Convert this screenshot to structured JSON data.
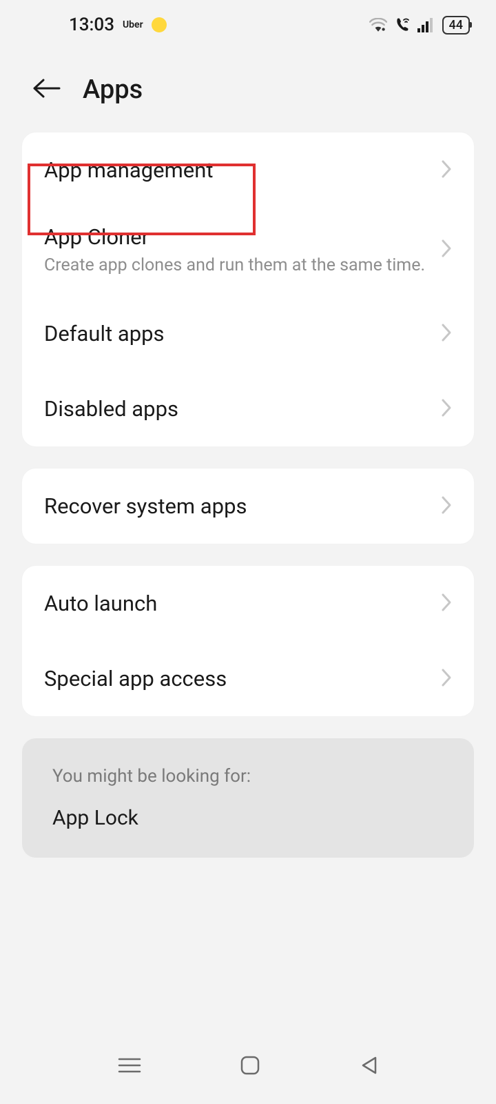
{
  "status": {
    "time": "13:03",
    "app_label": "Uber",
    "battery": "44"
  },
  "header": {
    "title": "Apps"
  },
  "groups": [
    {
      "items": [
        {
          "title": "App management",
          "subtitle": ""
        },
        {
          "title": "App Cloner",
          "subtitle": "Create app clones and run them at the same time."
        },
        {
          "title": "Default apps",
          "subtitle": ""
        },
        {
          "title": "Disabled apps",
          "subtitle": ""
        }
      ]
    },
    {
      "items": [
        {
          "title": "Recover system apps",
          "subtitle": ""
        }
      ]
    },
    {
      "items": [
        {
          "title": "Auto launch",
          "subtitle": ""
        },
        {
          "title": "Special app access",
          "subtitle": ""
        }
      ]
    }
  ],
  "suggestion": {
    "label": "You might be looking for:",
    "item": "App Lock"
  }
}
